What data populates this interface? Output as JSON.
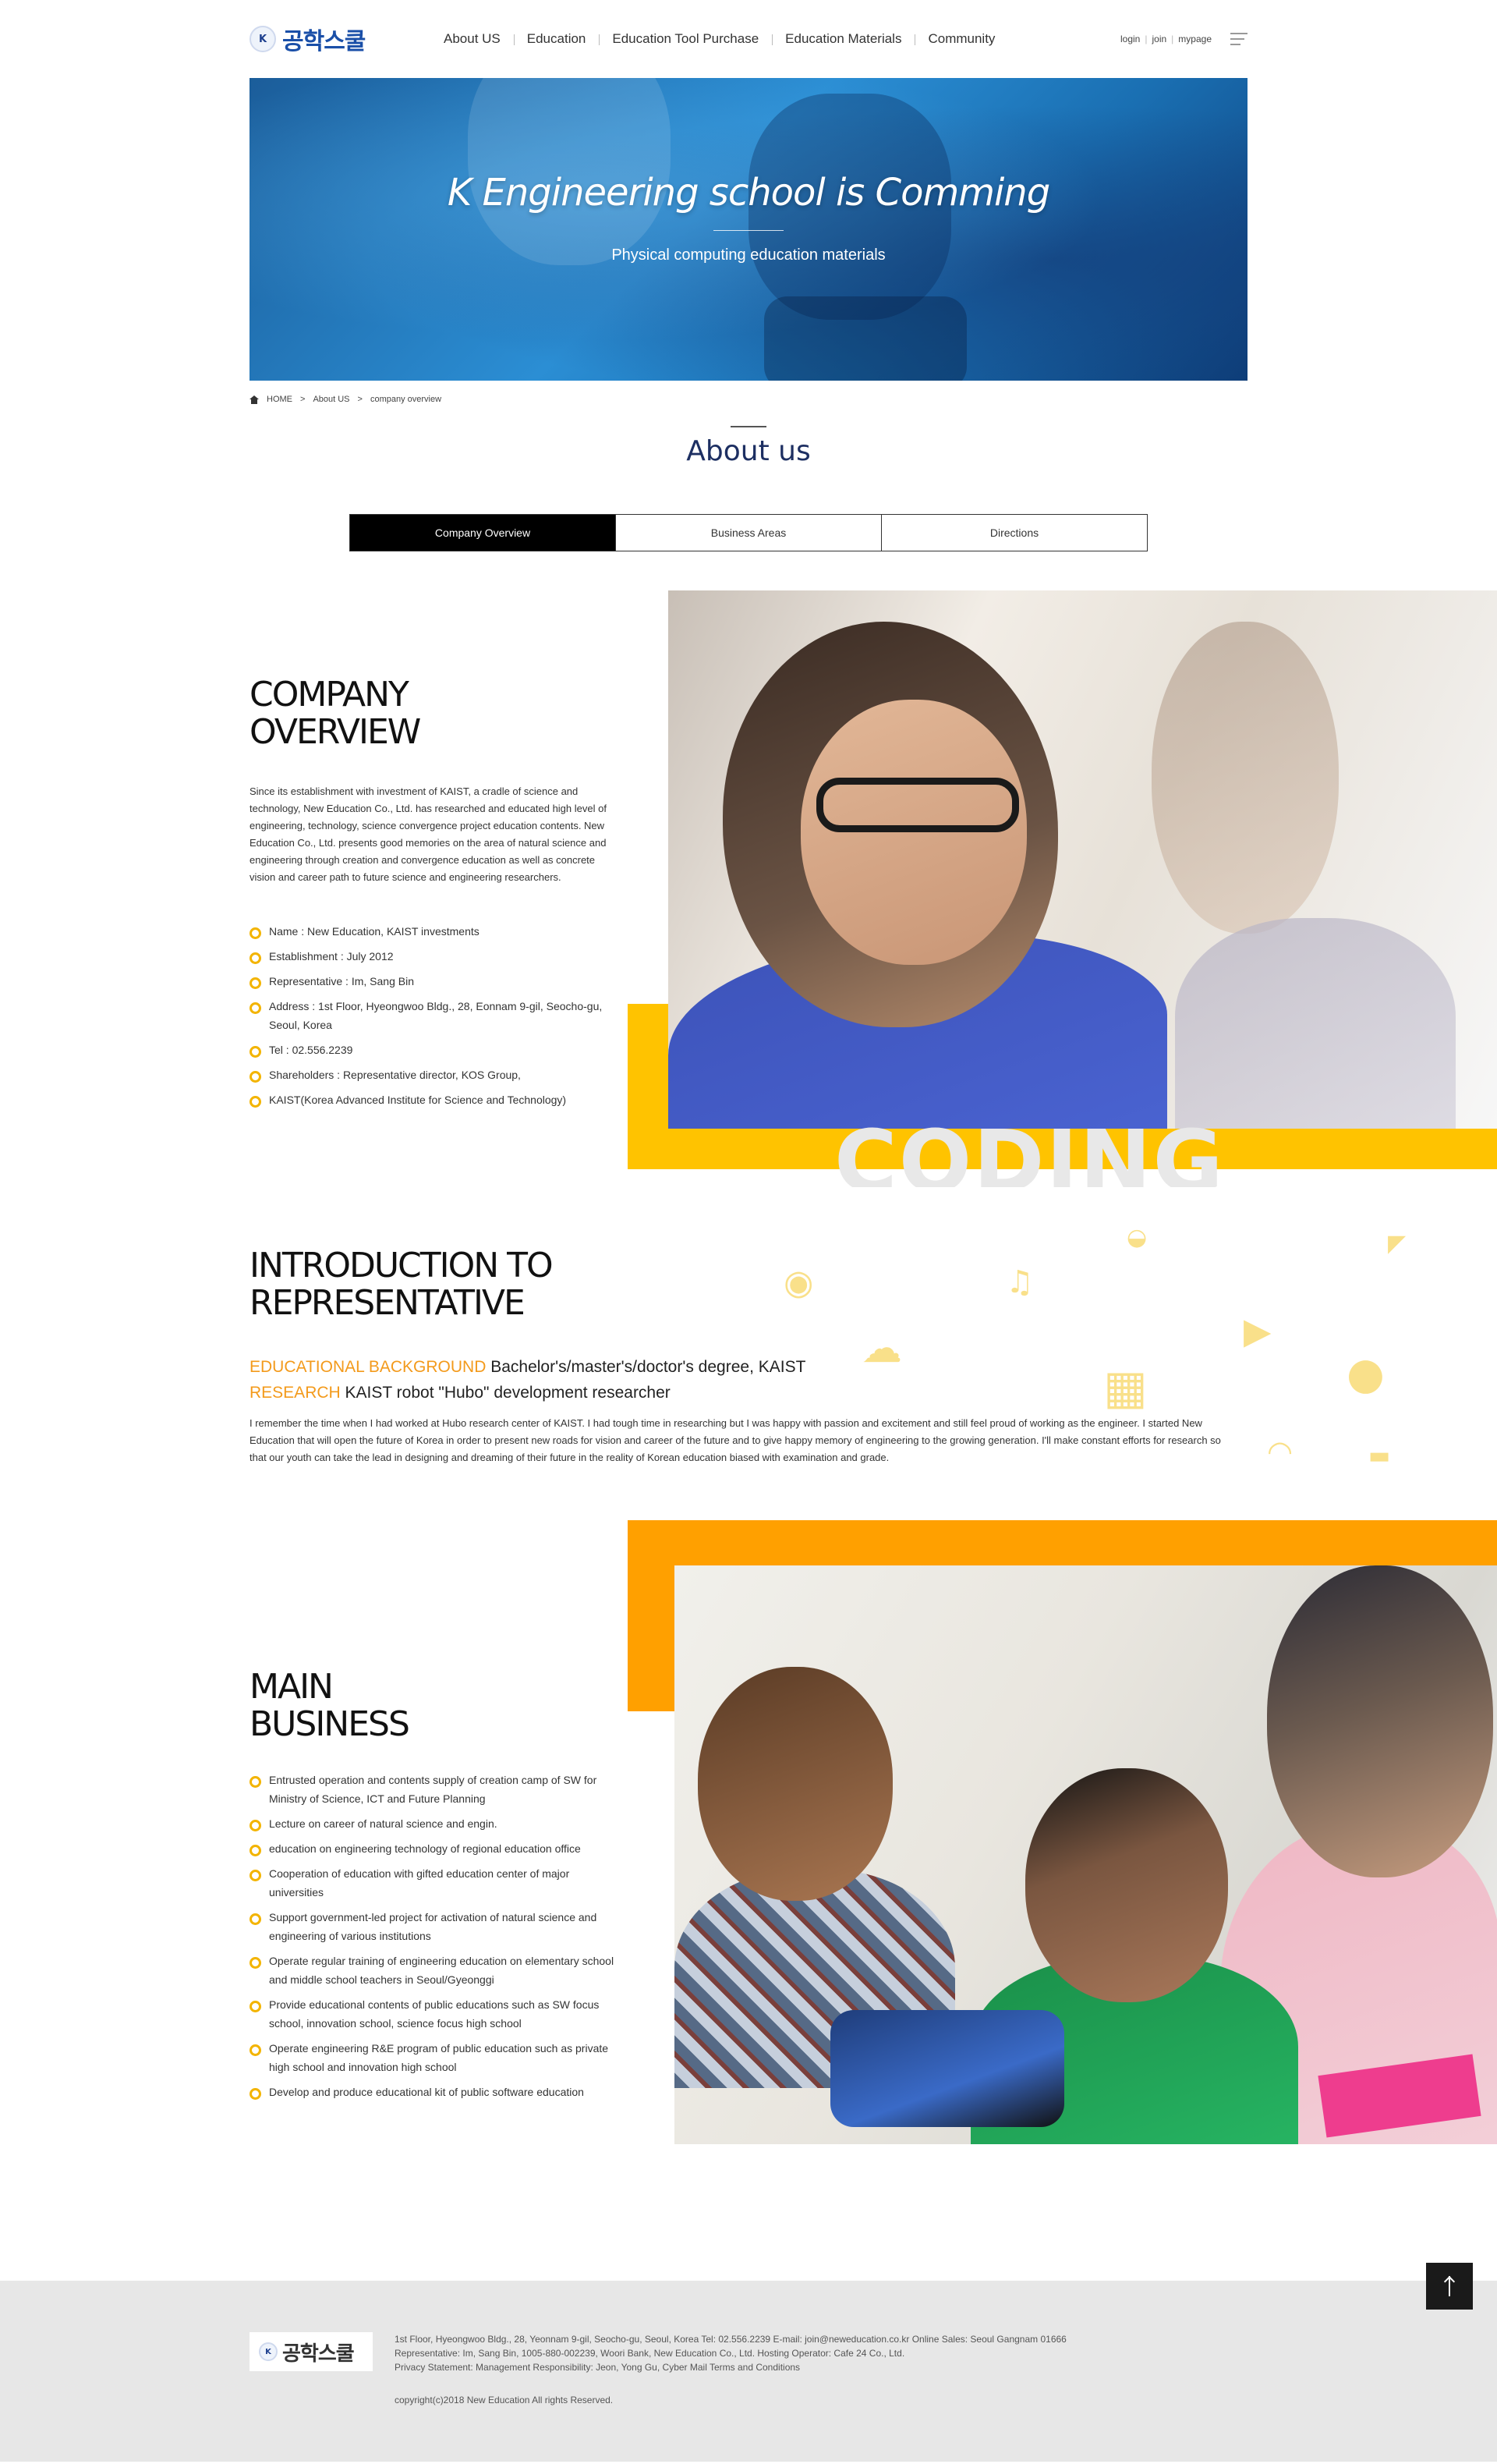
{
  "header": {
    "logo_text": "공학스쿨",
    "logo_mark": "K",
    "nav": [
      "About US",
      "Education",
      "Education Tool Purchase",
      "Education Materials",
      "Community"
    ],
    "util": [
      "login",
      "join",
      "mypage"
    ]
  },
  "hero": {
    "title": "K Engineering school is Comming",
    "subtitle": "Physical computing education materials"
  },
  "breadcrumb": [
    "HOME",
    "About US",
    "company overview"
  ],
  "page_title": "About us",
  "tabs": [
    "Company Overview",
    "Business Areas",
    "Directions"
  ],
  "overview": {
    "title_line1": "COMPANY",
    "title_line2": "OVERVIEW",
    "desc": "Since its establishment with investment of KAIST, a cradle of science and technology, New Education Co., Ltd. has researched and educated high level of engineering, technology, science convergence project education contents. New Education Co., Ltd. presents good memories on the area of natural science and engineering through creation and convergence education as well as concrete vision and career path to future science and engineering researchers.",
    "facts": [
      "Name : New Education, KAIST investments",
      "Establishment : July 2012",
      "Representative : Im, Sang Bin",
      "Address : 1st Floor, Hyeongwoo Bldg., 28, Eonnam 9-gil, Seocho-gu, Seoul, Korea",
      "Tel : 02.556.2239",
      "Shareholders : Representative director, KOS Group,",
      "KAIST(Korea Advanced Institute for Science and Technology)"
    ],
    "watermark": "CODING"
  },
  "representative": {
    "title_line1": "INTRODUCTION TO",
    "title_line2": "REPRESENTATIVE",
    "edu_tag": "EDUCATIONAL BACKGROUND",
    "edu_value": "Bachelor's/master's/doctor's degree, KAIST",
    "research_tag": "RESEARCH",
    "research_value": "KAIST robot \"Hubo\" development researcher",
    "desc": "I remember the time when I had worked at Hubo research center of KAIST. I had tough time in researching but I was happy with passion and excitement and still feel proud of working as the engineer. I started New Education that will open the future of Korea in order to present new roads for vision and career of the future and to give happy memory of engineering to the growing generation. I'll make constant efforts for research so that our youth can take the lead in designing and dreaming of their future in the reality of Korean education biased with examination and grade."
  },
  "business": {
    "title_line1": "MAIN",
    "title_line2": "BUSINESS",
    "items": [
      "Entrusted operation and contents supply of creation camp of SW for Ministry of Science, ICT and Future Planning",
      "Lecture on career of natural science and engin.",
      "education on engineering technology of regional education office",
      "Cooperation of education with gifted education center of major universities",
      "Support government-led project for activation of natural science and engineering of various institutions",
      "Operate regular training of engineering education on elementary school and middle school teachers in Seoul/Gyeonggi",
      "Provide educational contents of public educations such as SW focus school, innovation school, science focus high school",
      "Operate engineering R&E program of public education such as private high school and innovation high school",
      "Develop and produce educational kit of public software education"
    ]
  },
  "footer": {
    "logo_text": "공학스쿨",
    "line1": "1st Floor, Hyeongwoo Bldg., 28, Yeonnam 9-gil, Seocho-gu, Seoul, Korea     Tel: 02.556.2239     E-mail: join@neweducation.co.kr     Online Sales: Seoul Gangnam 01666",
    "line2": "Representative: Im, Sang Bin, 1005-880-002239, Woori Bank, New Education Co., Ltd. Hosting Operator: Cafe 24 Co., Ltd.",
    "line3": "Privacy Statement: Management Responsibility: Jeon, Yong Gu, Cyber Mail Terms and Conditions",
    "copyright": "copyright(c)2018 New Education All rights Reserved."
  },
  "icons": [
    "home-icon",
    "menu-icon",
    "location-icon",
    "music-icon",
    "globe-icon",
    "cursor-icon",
    "cloud-icon",
    "play-icon",
    "calendar-icon",
    "user-icon",
    "wifi-icon",
    "car-icon",
    "arrow-up-icon"
  ],
  "colors": {
    "accent_yellow": "#ffc300",
    "accent_orange": "#ffa000",
    "tag_orange": "#f39a1b",
    "title_navy": "#1d2f62"
  }
}
